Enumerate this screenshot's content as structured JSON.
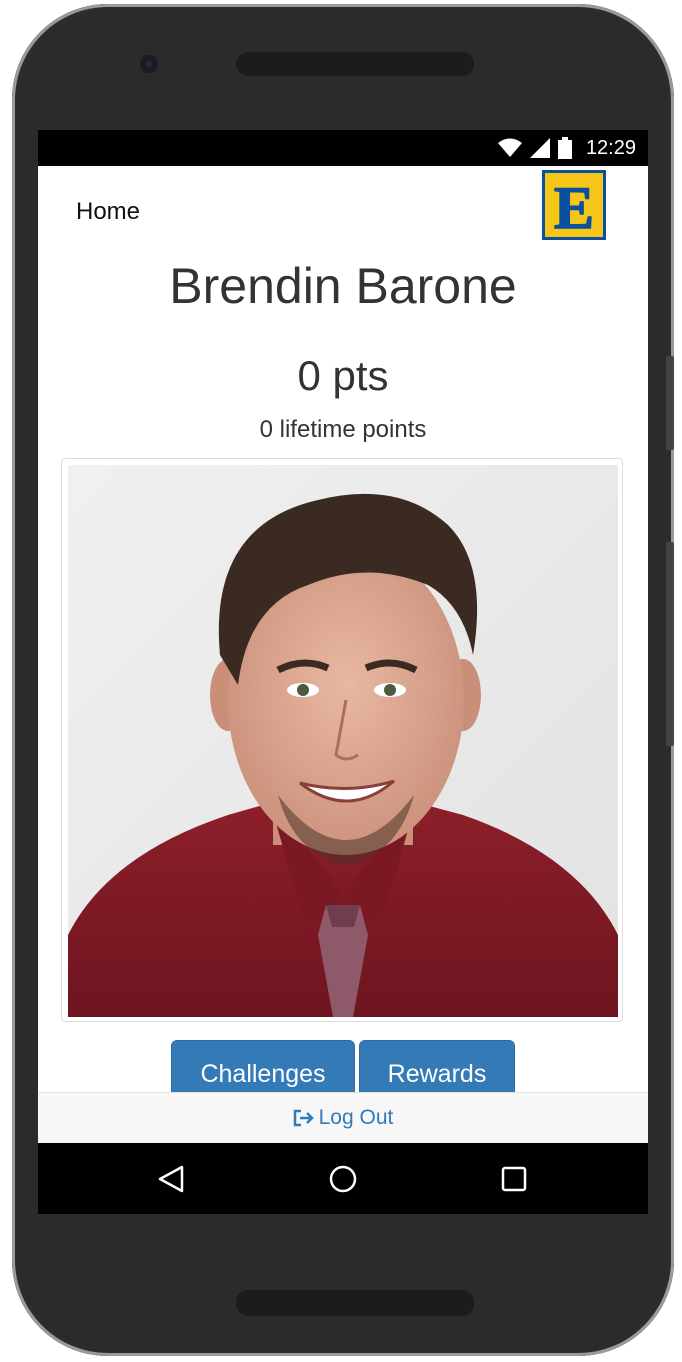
{
  "status_bar": {
    "time": "12:29",
    "icons": [
      "wifi-icon",
      "cell-signal-icon",
      "battery-icon"
    ]
  },
  "header": {
    "home_label": "Home",
    "logo_letter": "E",
    "logo_colors": {
      "fill": "#f5c518",
      "border": "#0a4fa0"
    }
  },
  "profile": {
    "name": "Brendin Barone",
    "points": "0 pts",
    "lifetime": "0 lifetime points"
  },
  "actions": {
    "challenges_label": "Challenges",
    "rewards_label": "Rewards"
  },
  "footer": {
    "logout_label": "Log Out",
    "logout_icon": "sign-out-icon"
  },
  "nav": {
    "icons": [
      "back-icon",
      "home-circle-icon",
      "recents-square-icon"
    ]
  },
  "colors": {
    "accent": "#337ab7",
    "text": "#333333"
  }
}
